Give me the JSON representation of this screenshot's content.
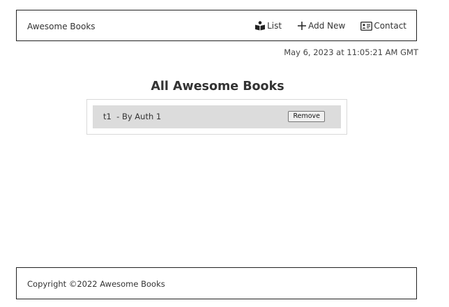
{
  "header": {
    "brand": "Awesome Books",
    "nav": [
      {
        "label": "List",
        "icon": "book-reader-icon"
      },
      {
        "label": "Add New",
        "icon": "plus-icon"
      },
      {
        "label": "Contact",
        "icon": "contact-card-icon"
      }
    ]
  },
  "date": "May 6, 2023 at 11:05:21 AM GMT",
  "main": {
    "title": "All Awesome Books",
    "books": [
      {
        "text": "t1  - By Auth 1",
        "remove_label": "Remove"
      }
    ]
  },
  "footer": {
    "copyright": "Copyright ©2022 Awesome Books"
  }
}
